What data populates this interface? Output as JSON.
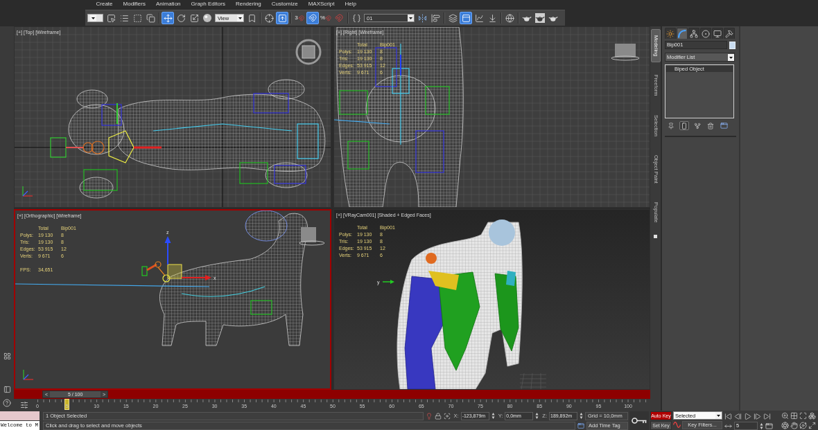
{
  "menu": [
    "Create",
    "Modifiers",
    "Animation",
    "Graph Editors",
    "Rendering",
    "Customize",
    "MAXScript",
    "Help"
  ],
  "toolbar": [
    {
      "kind": "dropdown"
    },
    {
      "kind": "button",
      "active": false
    },
    {
      "kind": "button",
      "active": false
    },
    {
      "kind": "button",
      "active": false
    },
    {
      "kind": "button",
      "active": false
    },
    {
      "kind": "separator"
    },
    {
      "kind": "button",
      "active": true
    },
    {
      "kind": "button",
      "active": false
    },
    {
      "kind": "button",
      "active": false
    },
    {
      "kind": "button",
      "active": false
    },
    {
      "kind": "dropdown",
      "value": "View"
    },
    {
      "kind": "button",
      "active": false
    },
    {
      "kind": "separator"
    },
    {
      "kind": "button",
      "active": false
    },
    {
      "kind": "button",
      "active": true
    },
    {
      "kind": "separator"
    },
    {
      "kind": "button",
      "active": false,
      "label": "3"
    },
    {
      "kind": "button",
      "active": true
    },
    {
      "kind": "button",
      "active": false,
      "label": "%"
    },
    {
      "kind": "button",
      "active": false
    },
    {
      "kind": "separator"
    },
    {
      "kind": "button",
      "active": false
    },
    {
      "kind": "combobox",
      "value": "01"
    },
    {
      "kind": "button",
      "active": false
    },
    {
      "kind": "button",
      "active": false
    },
    {
      "kind": "separator"
    },
    {
      "kind": "button",
      "active": false
    },
    {
      "kind": "button",
      "active": true
    },
    {
      "kind": "button",
      "active": false
    },
    {
      "kind": "button",
      "active": false
    },
    {
      "kind": "separator"
    },
    {
      "kind": "button",
      "active": false
    },
    {
      "kind": "separator"
    },
    {
      "kind": "button",
      "active": false
    },
    {
      "kind": "button",
      "active": false
    },
    {
      "kind": "button",
      "active": false
    }
  ],
  "viewports": [
    {
      "kind": "top",
      "labels": [
        "[+]",
        "[Top]",
        "[Wireframe]"
      ],
      "active": false
    },
    {
      "kind": "right",
      "labels": [
        "[+]",
        "[Right]",
        "[Wireframe]"
      ],
      "active": false,
      "stats": {
        "columns": [
          "Total",
          "Bip001"
        ],
        "rows": [
          {
            "label": "Polys:",
            "total": "19 130",
            "selection": "8"
          },
          {
            "label": "Tris:",
            "total": "19 130",
            "selection": "8"
          },
          {
            "label": "Edges:",
            "total": "53 915",
            "selection": "12"
          },
          {
            "label": "Verts:",
            "total": "9 671",
            "selection": "6"
          }
        ]
      }
    },
    {
      "kind": "orthographic",
      "labels": [
        "[+]",
        "[Orthographic]",
        "[Wireframe]"
      ],
      "active": true,
      "stats": {
        "columns": [
          "Total",
          "Bip001"
        ],
        "rows": [
          {
            "label": "Polys:",
            "total": "19 130",
            "selection": "8"
          },
          {
            "label": "Tris:",
            "total": "19 130",
            "selection": "8"
          },
          {
            "label": "Edges:",
            "total": "53 915",
            "selection": "12"
          },
          {
            "label": "Verts:",
            "total": "9 671",
            "selection": "6"
          }
        ],
        "fps": {
          "label": "FPS:",
          "value": "34,651"
        }
      },
      "gizmo_labels": [
        "z",
        "x"
      ]
    },
    {
      "kind": "camera",
      "labels": [
        "[+]",
        "[VRayCam001]",
        "[Shaded + Edged Faces]"
      ],
      "active": false,
      "stats": {
        "columns": [
          "Total",
          "Bip001"
        ],
        "rows": [
          {
            "label": "Polys:",
            "total": "19 130",
            "selection": "8"
          },
          {
            "label": "Tris:",
            "total": "19 130",
            "selection": "8"
          },
          {
            "label": "Edges:",
            "total": "53 915",
            "selection": "12"
          },
          {
            "label": "Verts:",
            "total": "9 671",
            "selection": "6"
          }
        ]
      },
      "gizmo_labels": [
        "y"
      ]
    }
  ],
  "ribbon_tabs": [
    {
      "label": "Modeling",
      "selected": true
    },
    {
      "label": "Freeform",
      "selected": false
    },
    {
      "label": "Selection",
      "selected": false
    },
    {
      "label": "Object Paint",
      "selected": false
    },
    {
      "label": "Populate",
      "selected": false
    }
  ],
  "command_panel": {
    "tabs": [
      {
        "selected": false
      },
      {
        "selected": true
      },
      {
        "selected": false
      },
      {
        "selected": false
      },
      {
        "selected": false
      },
      {
        "selected": false
      }
    ],
    "object_name": "Bip001",
    "modifier_list": "Modifier List",
    "stack": [
      "Biped Object"
    ],
    "stack_buttons": [
      {
        "active": false
      },
      {
        "active": true
      },
      {
        "active": false
      },
      {
        "active": false
      },
      {
        "active": false
      }
    ]
  },
  "time_slider": {
    "previous": "<",
    "label": "5 / 100",
    "next": ">",
    "level": 0.05
  },
  "track_bar": {
    "frame_labels": [
      "0",
      "5",
      "10",
      "15",
      "20",
      "25",
      "30",
      "35",
      "40",
      "45",
      "50",
      "55",
      "60",
      "65",
      "70",
      "75",
      "80",
      "85",
      "90",
      "95",
      "100"
    ]
  },
  "status_bar": {
    "listener_output": "Welcome to M",
    "prompt": "1 Object Selected",
    "hint": "Click and drag to select and move objects",
    "coordinates": [
      {
        "axis": "X:",
        "value": "-123,879m"
      },
      {
        "axis": "Y:",
        "value": "0,0mm"
      },
      {
        "axis": "Z:",
        "value": "189,892m"
      }
    ],
    "grid": "Grid = 10,0mm",
    "time_tag": "Add Time Tag",
    "auto_key": {
      "label": "Auto Key",
      "on": true
    },
    "set_key": "Set Key",
    "key_set": "Selected",
    "key_filters": "Key Filters...",
    "current_frame": "5"
  }
}
